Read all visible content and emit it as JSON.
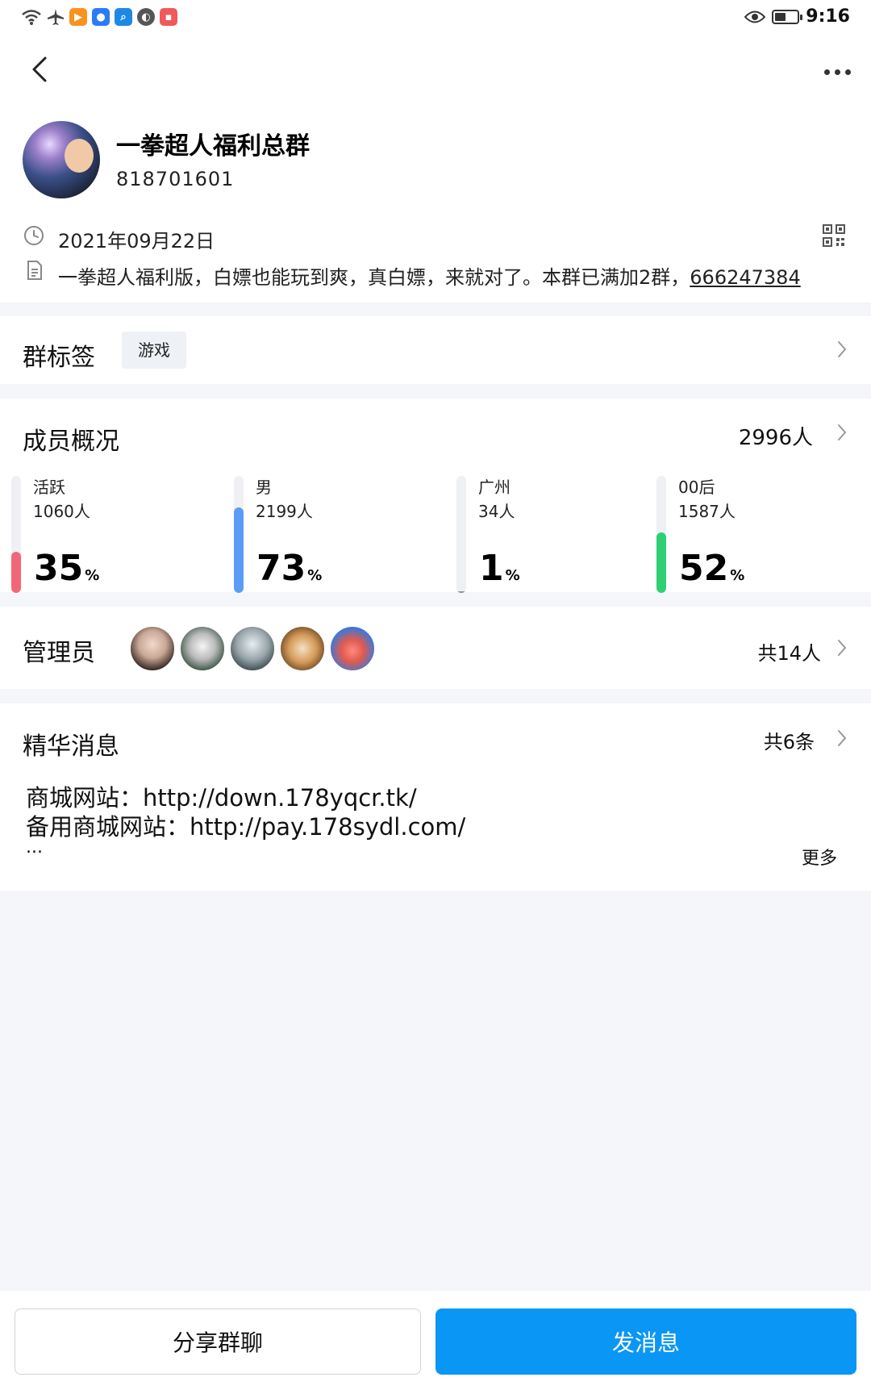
{
  "status_bar": {
    "time": "9:16",
    "battery_level": 0.5,
    "left_icons": [
      "wifi-icon",
      "airplane-icon",
      "app-icon-orange",
      "app-icon-blue",
      "app-icon-search",
      "app-icon-gray",
      "app-icon-red"
    ],
    "right_icons": [
      "eye-icon",
      "battery-icon"
    ]
  },
  "header": {
    "group_name": "一拳超人福利总群",
    "group_id": "818701601",
    "created_date": "2021年09月22日",
    "description": "一拳超人福利版，白嫖也能玩到爽，真白嫖，来就对了。本群已满加2群，",
    "description_link": "666247384"
  },
  "tags": {
    "title": "群标签",
    "items": [
      "游戏"
    ]
  },
  "members": {
    "title": "成员概况",
    "total": "2996人",
    "stats": [
      {
        "label": "活跃",
        "count": "1060人",
        "percent": "35",
        "unit": "%",
        "fill_fraction": 0.35,
        "color": "#f2667a"
      },
      {
        "label": "男",
        "count": "2199人",
        "percent": "73",
        "unit": "%",
        "fill_fraction": 0.73,
        "color": "#5b9cf5"
      },
      {
        "label": "广州",
        "count": "34人",
        "percent": "1",
        "unit": "%",
        "fill_fraction": 0.01,
        "color": "#8a8f98"
      },
      {
        "label": "00后",
        "count": "1587人",
        "percent": "52",
        "unit": "%",
        "fill_fraction": 0.52,
        "color": "#2fcf74"
      }
    ]
  },
  "admins": {
    "title": "管理员",
    "count": "共14人"
  },
  "essence": {
    "title": "精华消息",
    "count": "共6条",
    "lines": [
      "商城网站：http://down.178yqcr.tk/",
      "备用商城网站：http://pay.178sydl.com/",
      "..."
    ],
    "more": "更多"
  },
  "actions": {
    "share": "分享群聊",
    "send": "发消息"
  },
  "colors": {
    "primary": "#0a96f5",
    "page_bg": "#f4f6fa"
  }
}
